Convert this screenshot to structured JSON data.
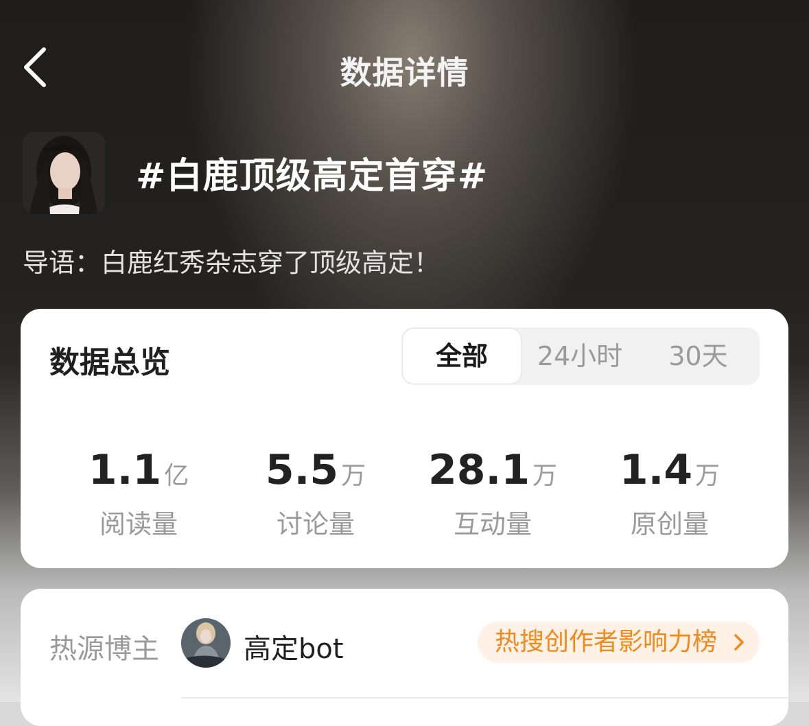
{
  "header": {
    "back_icon": "chevron-left-icon",
    "title": "数据详情"
  },
  "topic": {
    "title": "#白鹿顶级高定首穿#",
    "intro": "导语：白鹿红秀杂志穿了顶级高定！"
  },
  "overview": {
    "title": "数据总览",
    "tabs": [
      {
        "label": "全部",
        "active": true
      },
      {
        "label": "24小时",
        "active": false
      },
      {
        "label": "30天",
        "active": false
      }
    ],
    "stats": [
      {
        "value": "1.1",
        "unit": "亿",
        "label": "阅读量"
      },
      {
        "value": "5.5",
        "unit": "万",
        "label": "讨论量"
      },
      {
        "value": "28.1",
        "unit": "万",
        "label": "互动量"
      },
      {
        "value": "1.4",
        "unit": "万",
        "label": "原创量"
      }
    ]
  },
  "source": {
    "label": "热源博主",
    "blogger_name": "高定bot",
    "rank_label": "热搜创作者影响力榜",
    "rank_icon": "chevron-right-icon",
    "accent_color": "#f08a1c"
  }
}
